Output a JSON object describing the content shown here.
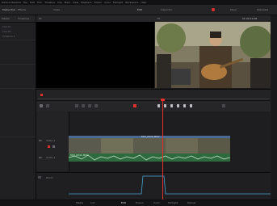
{
  "menubar": {
    "items": [
      "DaVinci Resolve",
      "File",
      "Edit",
      "Trim",
      "Timeline",
      "Clip",
      "Mark",
      "View",
      "Playback",
      "Fusion",
      "Color",
      "Fairlight",
      "Workspace",
      "Help"
    ]
  },
  "toolbar": {
    "left_buttons": [
      "Media Pool",
      "Effects",
      "Index"
    ],
    "center_tab": "Edit",
    "center_tab_2": "Inspector",
    "right_buttons": [
      "Mixer",
      "Metadata"
    ]
  },
  "mediapool": {
    "tabs": [
      "Master",
      "Timelines"
    ],
    "items": [
      "Clip 01",
      "Clip 02",
      "Timeline 1"
    ]
  },
  "viewer": {
    "timecode_left": "00:00:00:00",
    "timecode_right": "01:00:12:08",
    "zoom": "Fit"
  },
  "timeline": {
    "timecode": "01:00:12:08",
    "tracks": [
      {
        "id": "V1",
        "name": "Video 1"
      },
      {
        "id": "A1",
        "name": "Audio 1"
      }
    ],
    "video_clip_label": "MVI_2041.MOV",
    "audio_clip_label": "MVI_2041.MOV"
  },
  "keyframes": {
    "label": "Zoom"
  },
  "pages": [
    "Media",
    "Cut",
    "Edit",
    "Fusion",
    "Color",
    "Fairlight",
    "Deliver"
  ],
  "colors": {
    "accent": "#e0312b",
    "video_clip": "#3a4d6a",
    "audio_clip": "#2f6a3e",
    "keyframe_curve": "#4aa3d6"
  }
}
